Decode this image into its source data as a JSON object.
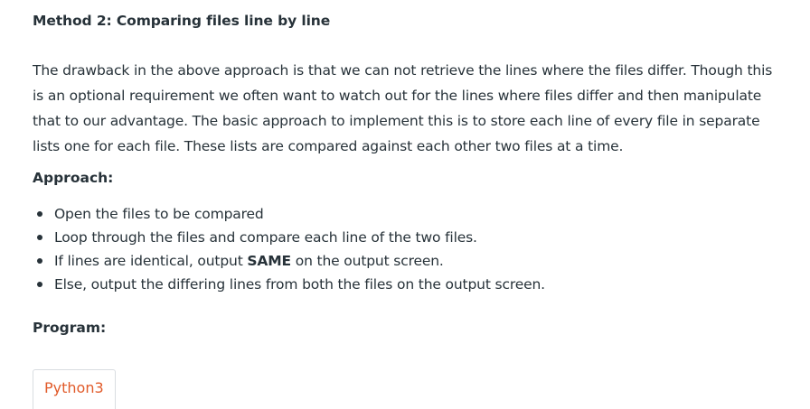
{
  "heading": "Method 2: Comparing files line by line",
  "paragraph": "The drawback in the above approach is that we can not retrieve the lines where the files differ. Though this is an optional requirement we often want to watch out for the lines where files differ and then manipulate that to our advantage. The basic approach to implement this is to store each line of every file in separate lists one for each file. These lists are compared against each other two files at a time.",
  "approach_label": "Approach:",
  "steps": [
    {
      "text": "Open the files to be compared"
    },
    {
      "text": "Loop through the files and compare each line of the two files."
    },
    {
      "before": "If lines are identical, output ",
      "bold": "SAME",
      "after": " on the output screen."
    },
    {
      "text": "Else, output the differing lines from both the files on the output screen."
    }
  ],
  "program_label": "Program:",
  "code_tab": {
    "label": "Python3",
    "color": "#e15b2a"
  },
  "colors": {
    "text": "#273239",
    "tab_border": "#d9dde1"
  }
}
